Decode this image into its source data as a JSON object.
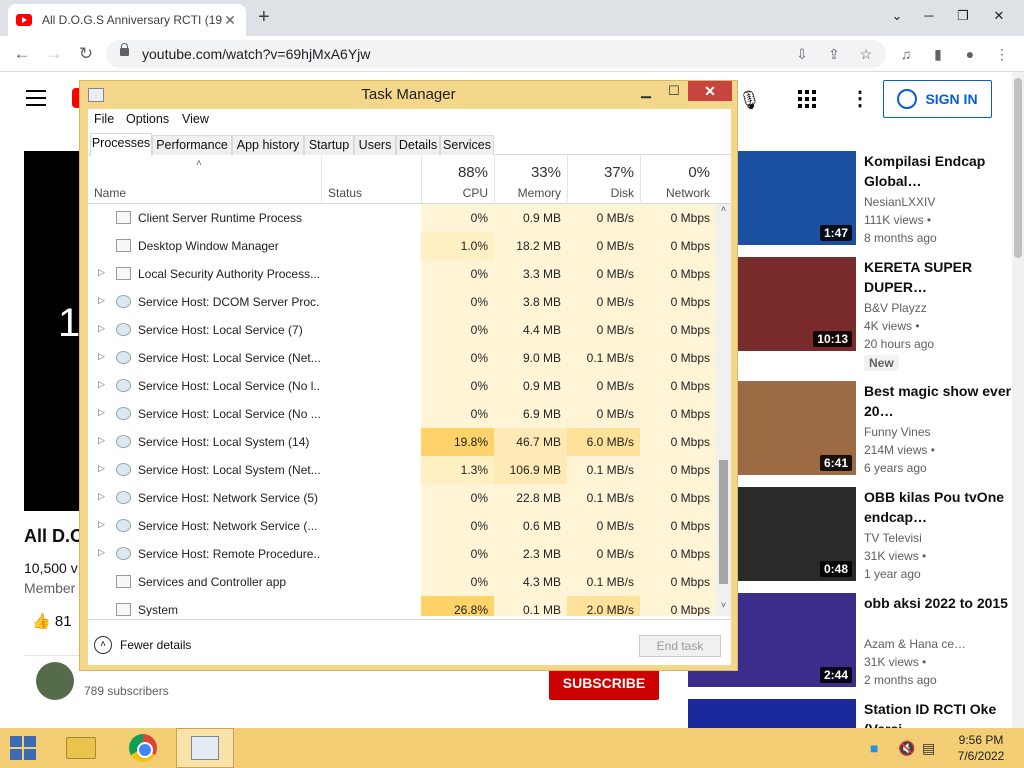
{
  "browser": {
    "tab_title": "All D.O.G.S Anniversary RCTI (19…",
    "tab_close": "✕",
    "new_tab": "+",
    "url": "youtube.com/watch?v=69hjMxA6Yjw",
    "window_min": "⌄",
    "window_max": "❐",
    "window_close": "✕"
  },
  "youtube": {
    "sign_in": "SIGN IN",
    "player_text": "1",
    "video_title": "All D.O",
    "views": "10,500 v",
    "member": "Member",
    "likes": "81",
    "channel_subs": "789 subscribers",
    "subscribe": "SUBSCRIBE",
    "recommendations": [
      {
        "title": "Kompilasi Endcap Global…",
        "channel": "NesianLXXIV",
        "views": "111K views •",
        "age": "8 months ago",
        "duration": "1:47",
        "thumb_color": "#1b4fa0"
      },
      {
        "title": "KERETA SUPER DUPER…",
        "channel": "B&V Playzz",
        "views": "4K views •",
        "age": "20 hours ago",
        "duration": "10:13",
        "badge": "New",
        "thumb_color": "#7a2b2b"
      },
      {
        "title": "Best magic show ever 20…",
        "channel": "Funny Vines",
        "views": "214M views •",
        "age": "6 years ago",
        "duration": "6:41",
        "thumb_color": "#9c6b44"
      },
      {
        "title": "OBB kilas Pou tvOne endcap…",
        "channel": "TV Televisi",
        "views": "31K views •",
        "age": "1 year ago",
        "duration": "0:48",
        "thumb_color": "#2a2a2a"
      },
      {
        "title": "obb aksi 2022 to 2015",
        "channel": "Azam & Hana ce…",
        "views": "31K views •",
        "age": "2 months ago",
        "duration": "2:44",
        "thumb_color": "#3b2e8a"
      },
      {
        "title": "Station ID RCTI Oke (Versi…",
        "channel": "",
        "views": "",
        "age": "",
        "duration": "",
        "thumb_color": "#1a2a9c"
      }
    ]
  },
  "task_manager": {
    "title": "Task Manager",
    "menu": [
      "File",
      "Options",
      "View"
    ],
    "tabs": [
      "Processes",
      "Performance",
      "App history",
      "Startup",
      "Users",
      "Details",
      "Services"
    ],
    "selected_tab": "Processes",
    "columns": {
      "name": "Name",
      "status": "Status",
      "cpu": {
        "pct": "88%",
        "label": "CPU"
      },
      "memory": {
        "pct": "33%",
        "label": "Memory"
      },
      "disk": {
        "pct": "37%",
        "label": "Disk"
      },
      "network": {
        "pct": "0%",
        "label": "Network"
      }
    },
    "sort_arrow": "˄",
    "rows": [
      {
        "name": "Client Server Runtime Process",
        "expand": false,
        "icon": "window",
        "cpu": "0%",
        "mem": "0.9 MB",
        "disk": "0 MB/s",
        "net": "0 Mbps"
      },
      {
        "name": "Desktop Window Manager",
        "expand": false,
        "icon": "window",
        "cpu": "1.0%",
        "mem": "18.2 MB",
        "disk": "0 MB/s",
        "net": "0 Mbps"
      },
      {
        "name": "Local Security Authority Process...",
        "expand": true,
        "icon": "window",
        "cpu": "0%",
        "mem": "3.3 MB",
        "disk": "0 MB/s",
        "net": "0 Mbps"
      },
      {
        "name": "Service Host: DCOM Server Proc...",
        "expand": true,
        "icon": "gear",
        "cpu": "0%",
        "mem": "3.8 MB",
        "disk": "0 MB/s",
        "net": "0 Mbps"
      },
      {
        "name": "Service Host: Local Service (7)",
        "expand": true,
        "icon": "gear",
        "cpu": "0%",
        "mem": "4.4 MB",
        "disk": "0 MB/s",
        "net": "0 Mbps"
      },
      {
        "name": "Service Host: Local Service (Net...",
        "expand": true,
        "icon": "gear",
        "cpu": "0%",
        "mem": "9.0 MB",
        "disk": "0.1 MB/s",
        "net": "0 Mbps"
      },
      {
        "name": "Service Host: Local Service (No l...",
        "expand": true,
        "icon": "gear",
        "cpu": "0%",
        "mem": "0.9 MB",
        "disk": "0 MB/s",
        "net": "0 Mbps"
      },
      {
        "name": "Service Host: Local Service (No ...",
        "expand": true,
        "icon": "gear",
        "cpu": "0%",
        "mem": "6.9 MB",
        "disk": "0 MB/s",
        "net": "0 Mbps"
      },
      {
        "name": "Service Host: Local System (14)",
        "expand": true,
        "icon": "gear",
        "cpu": "19.8%",
        "mem": "46.7 MB",
        "disk": "6.0 MB/s",
        "net": "0 Mbps"
      },
      {
        "name": "Service Host: Local System (Net...",
        "expand": true,
        "icon": "gear",
        "cpu": "1.3%",
        "mem": "106.9 MB",
        "disk": "0.1 MB/s",
        "net": "0 Mbps"
      },
      {
        "name": "Service Host: Network Service (5)",
        "expand": true,
        "icon": "gear",
        "cpu": "0%",
        "mem": "22.8 MB",
        "disk": "0.1 MB/s",
        "net": "0 Mbps"
      },
      {
        "name": "Service Host: Network Service (...",
        "expand": true,
        "icon": "gear",
        "cpu": "0%",
        "mem": "0.6 MB",
        "disk": "0 MB/s",
        "net": "0 Mbps"
      },
      {
        "name": "Service Host: Remote Procedure...",
        "expand": true,
        "icon": "gear",
        "cpu": "0%",
        "mem": "2.3 MB",
        "disk": "0 MB/s",
        "net": "0 Mbps"
      },
      {
        "name": "Services and Controller app",
        "expand": false,
        "icon": "window",
        "cpu": "0%",
        "mem": "4.3 MB",
        "disk": "0.1 MB/s",
        "net": "0 Mbps"
      },
      {
        "name": "System",
        "expand": false,
        "icon": "window",
        "cpu": "26.8%",
        "mem": "0.1 MB",
        "disk": "2.0 MB/s",
        "net": "0 Mbps"
      }
    ],
    "fewer_details": "Fewer details",
    "end_task": "End task"
  },
  "taskbar": {
    "time": "9:56 PM",
    "date": "7/6/2022"
  }
}
